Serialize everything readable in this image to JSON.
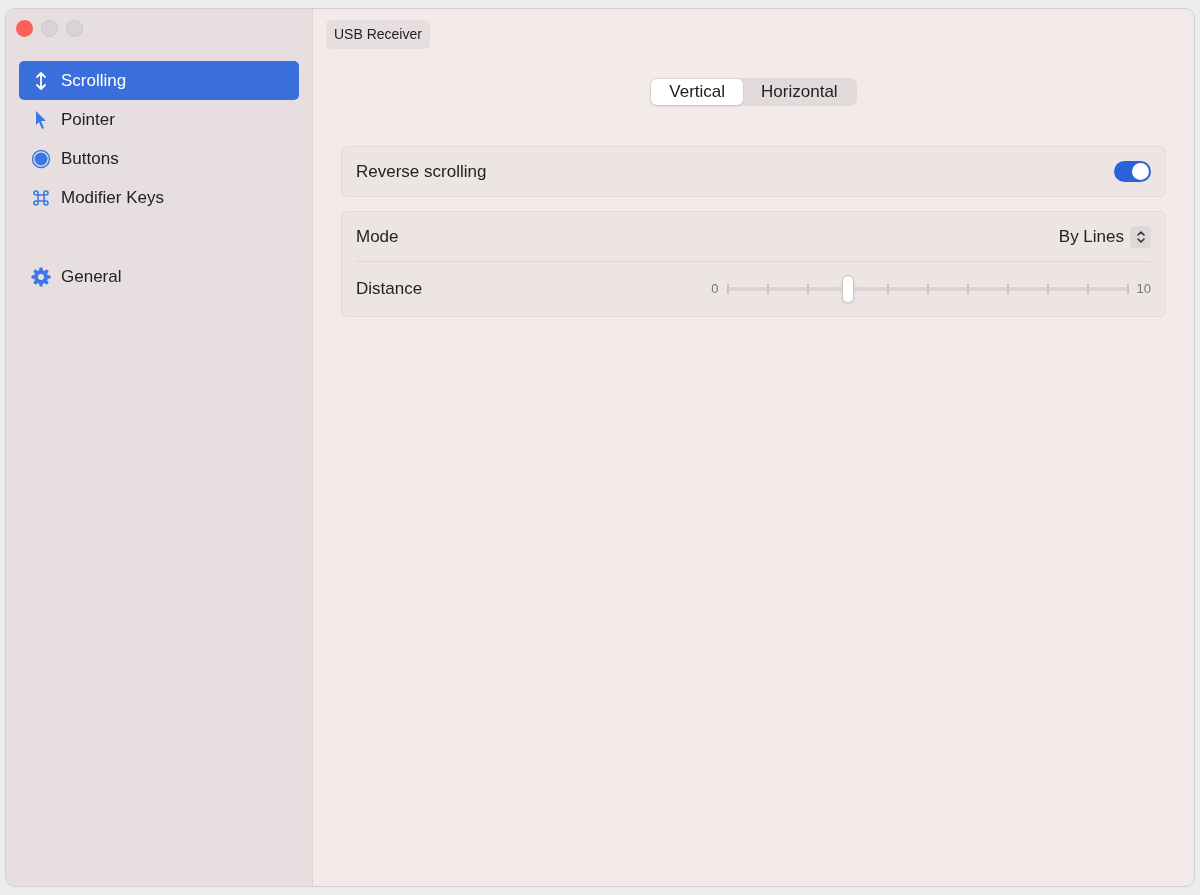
{
  "sidebar": {
    "groups": [
      {
        "items": [
          {
            "label": "Scrolling",
            "selected": true
          },
          {
            "label": "Pointer",
            "selected": false
          },
          {
            "label": "Buttons",
            "selected": false
          },
          {
            "label": "Modifier Keys",
            "selected": false
          }
        ]
      },
      {
        "items": [
          {
            "label": "General",
            "selected": false
          }
        ]
      }
    ]
  },
  "device": {
    "label": "USB Receiver"
  },
  "tabs": [
    {
      "label": "Vertical",
      "selected": true
    },
    {
      "label": "Horizontal",
      "selected": false
    }
  ],
  "sections": [
    {
      "rows": [
        {
          "kind": "toggle",
          "label": "Reverse scrolling",
          "on": true
        }
      ]
    },
    {
      "rows": [
        {
          "kind": "popup",
          "label": "Mode",
          "value": "By Lines"
        },
        {
          "kind": "slider",
          "label": "Distance",
          "min_label": "0",
          "max_label": "10",
          "level": 0.3
        }
      ]
    }
  ]
}
